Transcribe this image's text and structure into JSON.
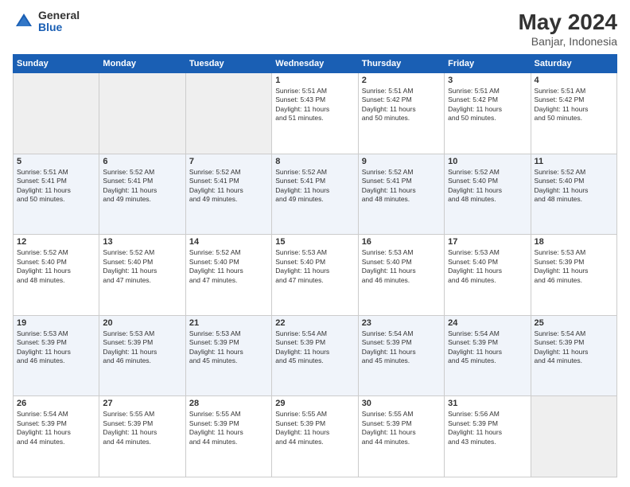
{
  "logo": {
    "general": "General",
    "blue": "Blue"
  },
  "title": {
    "month": "May 2024",
    "location": "Banjar, Indonesia"
  },
  "weekdays": [
    "Sunday",
    "Monday",
    "Tuesday",
    "Wednesday",
    "Thursday",
    "Friday",
    "Saturday"
  ],
  "weeks": [
    [
      {
        "day": "",
        "info": ""
      },
      {
        "day": "",
        "info": ""
      },
      {
        "day": "",
        "info": ""
      },
      {
        "day": "1",
        "info": "Sunrise: 5:51 AM\nSunset: 5:43 PM\nDaylight: 11 hours\nand 51 minutes."
      },
      {
        "day": "2",
        "info": "Sunrise: 5:51 AM\nSunset: 5:42 PM\nDaylight: 11 hours\nand 50 minutes."
      },
      {
        "day": "3",
        "info": "Sunrise: 5:51 AM\nSunset: 5:42 PM\nDaylight: 11 hours\nand 50 minutes."
      },
      {
        "day": "4",
        "info": "Sunrise: 5:51 AM\nSunset: 5:42 PM\nDaylight: 11 hours\nand 50 minutes."
      }
    ],
    [
      {
        "day": "5",
        "info": "Sunrise: 5:51 AM\nSunset: 5:41 PM\nDaylight: 11 hours\nand 50 minutes."
      },
      {
        "day": "6",
        "info": "Sunrise: 5:52 AM\nSunset: 5:41 PM\nDaylight: 11 hours\nand 49 minutes."
      },
      {
        "day": "7",
        "info": "Sunrise: 5:52 AM\nSunset: 5:41 PM\nDaylight: 11 hours\nand 49 minutes."
      },
      {
        "day": "8",
        "info": "Sunrise: 5:52 AM\nSunset: 5:41 PM\nDaylight: 11 hours\nand 49 minutes."
      },
      {
        "day": "9",
        "info": "Sunrise: 5:52 AM\nSunset: 5:41 PM\nDaylight: 11 hours\nand 48 minutes."
      },
      {
        "day": "10",
        "info": "Sunrise: 5:52 AM\nSunset: 5:40 PM\nDaylight: 11 hours\nand 48 minutes."
      },
      {
        "day": "11",
        "info": "Sunrise: 5:52 AM\nSunset: 5:40 PM\nDaylight: 11 hours\nand 48 minutes."
      }
    ],
    [
      {
        "day": "12",
        "info": "Sunrise: 5:52 AM\nSunset: 5:40 PM\nDaylight: 11 hours\nand 48 minutes."
      },
      {
        "day": "13",
        "info": "Sunrise: 5:52 AM\nSunset: 5:40 PM\nDaylight: 11 hours\nand 47 minutes."
      },
      {
        "day": "14",
        "info": "Sunrise: 5:52 AM\nSunset: 5:40 PM\nDaylight: 11 hours\nand 47 minutes."
      },
      {
        "day": "15",
        "info": "Sunrise: 5:53 AM\nSunset: 5:40 PM\nDaylight: 11 hours\nand 47 minutes."
      },
      {
        "day": "16",
        "info": "Sunrise: 5:53 AM\nSunset: 5:40 PM\nDaylight: 11 hours\nand 46 minutes."
      },
      {
        "day": "17",
        "info": "Sunrise: 5:53 AM\nSunset: 5:40 PM\nDaylight: 11 hours\nand 46 minutes."
      },
      {
        "day": "18",
        "info": "Sunrise: 5:53 AM\nSunset: 5:39 PM\nDaylight: 11 hours\nand 46 minutes."
      }
    ],
    [
      {
        "day": "19",
        "info": "Sunrise: 5:53 AM\nSunset: 5:39 PM\nDaylight: 11 hours\nand 46 minutes."
      },
      {
        "day": "20",
        "info": "Sunrise: 5:53 AM\nSunset: 5:39 PM\nDaylight: 11 hours\nand 46 minutes."
      },
      {
        "day": "21",
        "info": "Sunrise: 5:53 AM\nSunset: 5:39 PM\nDaylight: 11 hours\nand 45 minutes."
      },
      {
        "day": "22",
        "info": "Sunrise: 5:54 AM\nSunset: 5:39 PM\nDaylight: 11 hours\nand 45 minutes."
      },
      {
        "day": "23",
        "info": "Sunrise: 5:54 AM\nSunset: 5:39 PM\nDaylight: 11 hours\nand 45 minutes."
      },
      {
        "day": "24",
        "info": "Sunrise: 5:54 AM\nSunset: 5:39 PM\nDaylight: 11 hours\nand 45 minutes."
      },
      {
        "day": "25",
        "info": "Sunrise: 5:54 AM\nSunset: 5:39 PM\nDaylight: 11 hours\nand 44 minutes."
      }
    ],
    [
      {
        "day": "26",
        "info": "Sunrise: 5:54 AM\nSunset: 5:39 PM\nDaylight: 11 hours\nand 44 minutes."
      },
      {
        "day": "27",
        "info": "Sunrise: 5:55 AM\nSunset: 5:39 PM\nDaylight: 11 hours\nand 44 minutes."
      },
      {
        "day": "28",
        "info": "Sunrise: 5:55 AM\nSunset: 5:39 PM\nDaylight: 11 hours\nand 44 minutes."
      },
      {
        "day": "29",
        "info": "Sunrise: 5:55 AM\nSunset: 5:39 PM\nDaylight: 11 hours\nand 44 minutes."
      },
      {
        "day": "30",
        "info": "Sunrise: 5:55 AM\nSunset: 5:39 PM\nDaylight: 11 hours\nand 44 minutes."
      },
      {
        "day": "31",
        "info": "Sunrise: 5:56 AM\nSunset: 5:39 PM\nDaylight: 11 hours\nand 43 minutes."
      },
      {
        "day": "",
        "info": ""
      }
    ]
  ]
}
